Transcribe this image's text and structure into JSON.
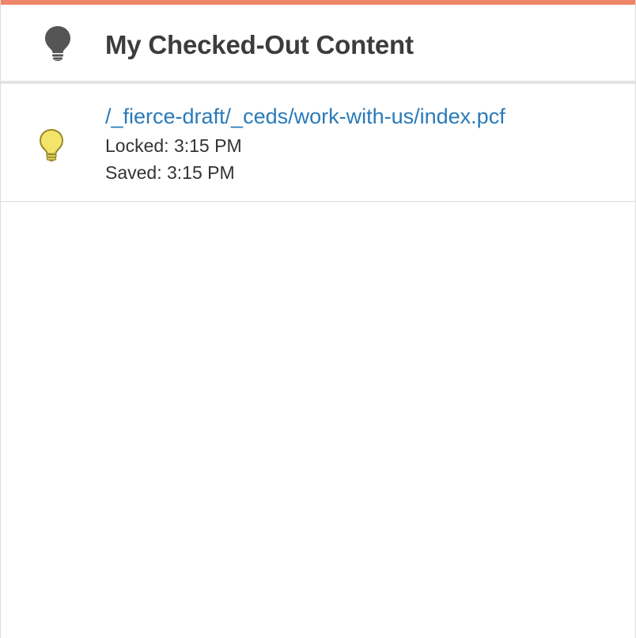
{
  "colors": {
    "accent": "#ef8669",
    "link": "#2a7ab9",
    "header_icon": "#555555",
    "bulb_fill": "#f3e46a",
    "bulb_stroke": "#9a8b2a"
  },
  "header": {
    "icon": "lightbulb-icon",
    "title": "My Checked-Out Content"
  },
  "items": [
    {
      "icon": "lightbulb-lit-icon",
      "path": "/_fierce-draft/_ceds/work-with-us/index.pcf",
      "locked": "Locked: 3:15 PM",
      "saved": "Saved: 3:15 PM"
    }
  ]
}
